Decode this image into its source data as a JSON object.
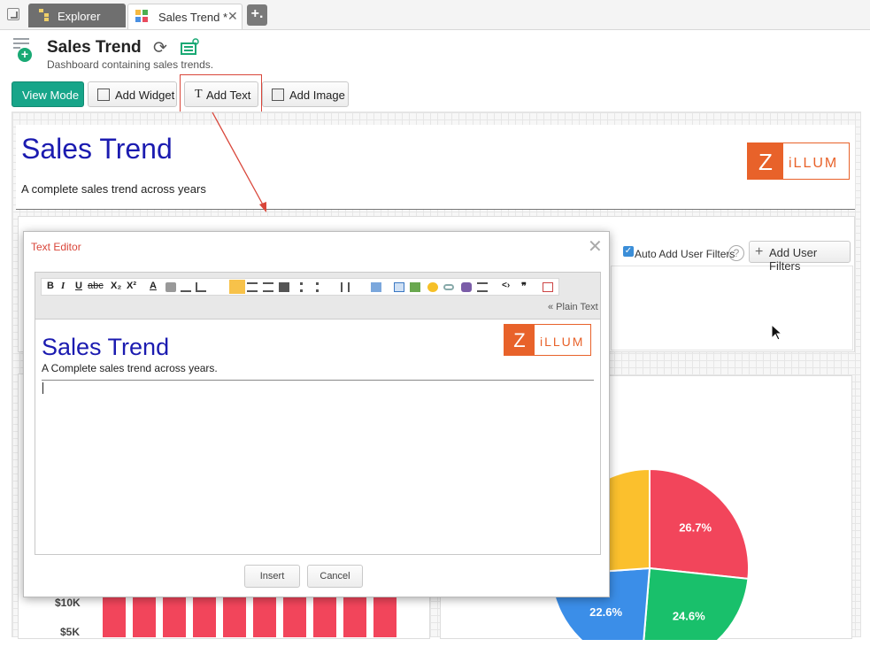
{
  "tabs": {
    "explorer_label": "Explorer",
    "active_label": "Sales Trend *",
    "close_symbol": "✕",
    "new_symbol": "+."
  },
  "header": {
    "title": "Sales Trend",
    "subtitle": "Dashboard containing sales trends."
  },
  "toolbar": {
    "view_mode": "View Mode",
    "add_widget": "Add Widget",
    "add_text": "Add Text",
    "add_image": "Add Image"
  },
  "text_widget": {
    "title": "Sales Trend",
    "subtitle": "A complete sales trend across years"
  },
  "logo": {
    "letter": "Z",
    "rest": "iLLUM"
  },
  "filters": {
    "auto_add_label": "Auto Add User Filters",
    "auto_add_checked": true,
    "help_symbol": "?",
    "add_button": "Add User Filters"
  },
  "bar_chart": {
    "ticks": [
      "$10K",
      "$5K"
    ]
  },
  "chart_data": {
    "type": "pie",
    "values": [
      26.7,
      24.6,
      22.6,
      26.1
    ],
    "labels": [
      "26.7%",
      "24.6%",
      "22.6%",
      ""
    ],
    "colors": [
      "#f2455b",
      "#19c06b",
      "#3b8ee8",
      "#fbc02d"
    ]
  },
  "text_editor": {
    "title": "Text Editor",
    "close_symbol": "✕",
    "plain_text_link": "« Plain Text",
    "content_title": "Sales Trend",
    "content_subtitle": "A Complete sales trend across years.",
    "insert_button": "Insert",
    "cancel_button": "Cancel",
    "tools": {
      "bold": "B",
      "italic": "I",
      "underline": "U",
      "strike": "abc",
      "subscript": "X₂",
      "superscript": "X²",
      "font_color": "A",
      "source": "<›",
      "quote": "❞"
    }
  },
  "colors": {
    "accent": "#17a589",
    "title_blue": "#1b1bb0",
    "logo_orange": "#e8622a",
    "highlight_red": "#d9463a"
  }
}
